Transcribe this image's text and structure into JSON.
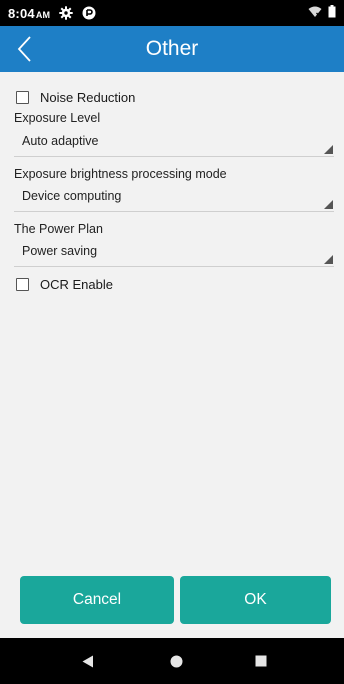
{
  "status_bar": {
    "time": "8:04",
    "ampm": "AM",
    "icons": [
      "gear-icon",
      "sync-icon",
      "wifi-icon",
      "battery-icon"
    ]
  },
  "app_bar": {
    "title": "Other",
    "back_icon": "chevron-left-icon",
    "color": "#1e7fc6"
  },
  "settings": {
    "noise_reduction": {
      "label": "Noise Reduction",
      "checked": false
    },
    "exposure_level": {
      "label": "Exposure Level",
      "value": "Auto adaptive"
    },
    "exposure_mode": {
      "label": "Exposure brightness processing mode",
      "value": "Device computing"
    },
    "power_plan": {
      "label": "The Power Plan",
      "value": "Power saving"
    },
    "ocr_enable": {
      "label": "OCR Enable",
      "checked": false
    }
  },
  "buttons": {
    "cancel_label": "Cancel",
    "ok_label": "OK",
    "color": "#1aa79b"
  },
  "nav_bar": {
    "icons": [
      "back-triangle-icon",
      "home-circle-icon",
      "recents-square-icon"
    ]
  }
}
